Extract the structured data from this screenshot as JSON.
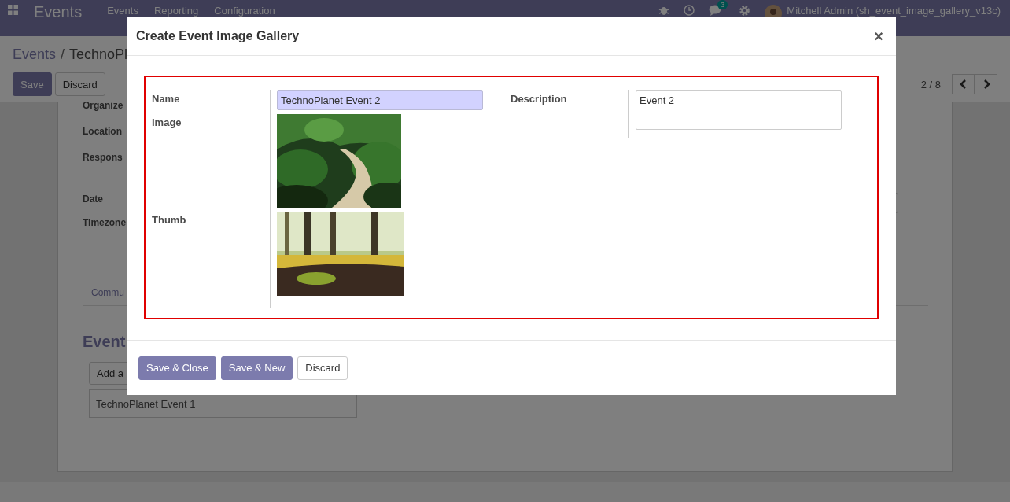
{
  "navbar": {
    "app_title": "Events",
    "menu": [
      "Events",
      "Reporting",
      "Configuration"
    ],
    "chat_count": "3",
    "user": "Mitchell Admin (sh_event_image_gallery_v13c)"
  },
  "breadcrumb": [
    "Events",
    "TechnoPl"
  ],
  "breadcrumb_separator": "/",
  "actions": [
    "Save",
    "Discard"
  ],
  "pager": "2 / 8",
  "form": {
    "labels": [
      "Organize",
      "Location",
      "Respons",
      "Date",
      "Timezone"
    ],
    "tab": "Commu",
    "section_title": "Event",
    "add_button": "Add a",
    "rows": [
      "TechnoPlanet Event 1"
    ]
  },
  "dialog": {
    "title": "Create Event Image Gallery",
    "close": "×",
    "name_label": "Name",
    "name_value": "TechnoPlanet Event 2",
    "image_label": "Image",
    "thumb_label": "Thumb",
    "description_label": "Description",
    "description_value": "Event 2",
    "buttons": [
      {
        "label": "Save & Close",
        "kind": "primary"
      },
      {
        "label": "Save & New",
        "kind": "primary"
      },
      {
        "label": "Discard",
        "kind": "secondary"
      }
    ]
  }
}
